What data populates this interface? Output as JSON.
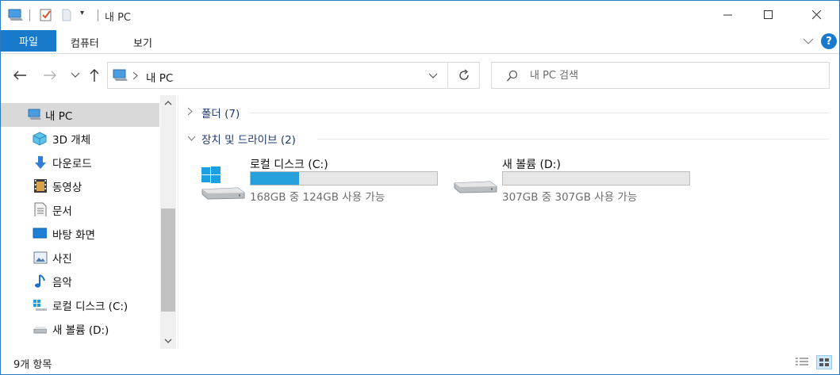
{
  "window": {
    "title": "내 PC",
    "controls": [
      "minimize-icon",
      "maximize-icon",
      "close-icon"
    ]
  },
  "ribbon": {
    "tabs": [
      {
        "label": "파일",
        "active": true
      },
      {
        "label": "컴퓨터",
        "active": false
      },
      {
        "label": "보기",
        "active": false
      }
    ],
    "help": "?"
  },
  "address": {
    "path_label": "내 PC",
    "separator": ">"
  },
  "search": {
    "placeholder": "내 PC 검색"
  },
  "nav": {
    "items": [
      {
        "label": "내 PC",
        "icon": "computer-icon",
        "selected": true
      },
      {
        "label": "3D 개체",
        "icon": "cube-icon"
      },
      {
        "label": "다운로드",
        "icon": "download-arrow-icon"
      },
      {
        "label": "동영상",
        "icon": "film-icon"
      },
      {
        "label": "문서",
        "icon": "document-icon"
      },
      {
        "label": "바탕 화면",
        "icon": "desktop-icon"
      },
      {
        "label": "사진",
        "icon": "picture-icon"
      },
      {
        "label": "음악",
        "icon": "music-note-icon"
      },
      {
        "label": "로컬 디스크 (C:)",
        "icon": "windows-drive-icon"
      },
      {
        "label": "새 볼륨 (D:)",
        "icon": "drive-icon"
      }
    ]
  },
  "content": {
    "groups": [
      {
        "title": "폴더 (7)",
        "expanded": false
      },
      {
        "title": "장치 및 드라이브 (2)",
        "expanded": true
      }
    ],
    "drives": [
      {
        "name": "로컬 디스크 (C:)",
        "free_text": "168GB 중 124GB 사용 가능",
        "used_fraction": 0.26,
        "icon": "windows-drive-icon"
      },
      {
        "name": "새 볼륨 (D:)",
        "free_text": "307GB 중 307GB 사용 가능",
        "used_fraction": 0.0,
        "icon": "drive-icon"
      }
    ]
  },
  "status": {
    "item_count": "9개 항목"
  },
  "colors": {
    "accent": "#1979ca",
    "drive_fill": "#26a0da",
    "group_title": "#1e3a6e"
  }
}
